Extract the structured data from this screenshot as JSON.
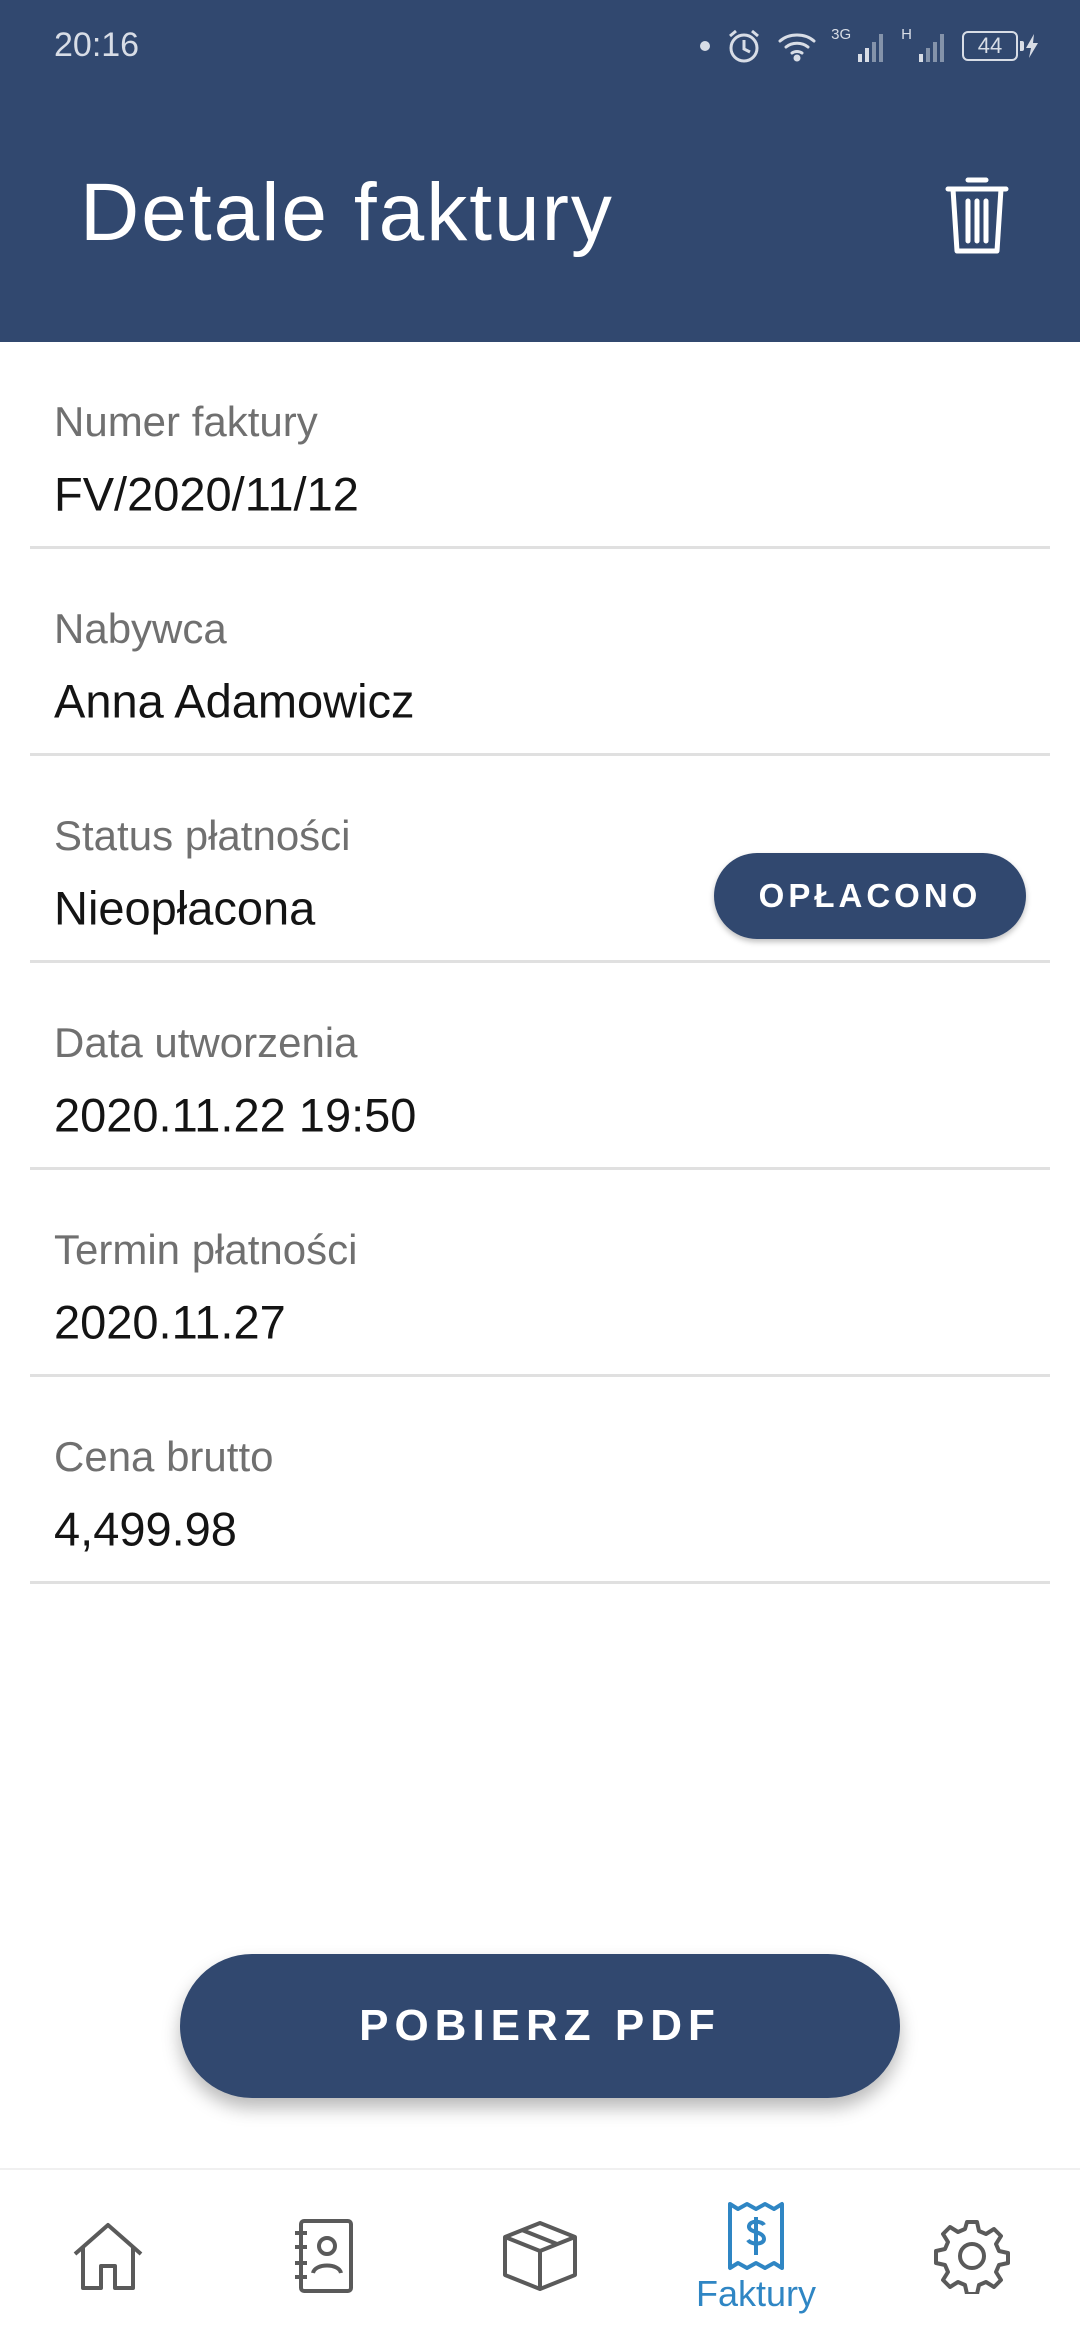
{
  "status_bar": {
    "time": "20:16",
    "network_3g": "3G",
    "network_h": "H",
    "battery": "44"
  },
  "header": {
    "title": "Detale faktury",
    "delete_icon": "trash-icon"
  },
  "details": [
    {
      "label": "Numer faktury",
      "value": "FV/2020/11/12"
    },
    {
      "label": "Nabywca",
      "value": "Anna Adamowicz"
    },
    {
      "label": "Status płatności",
      "value": "Nieopłacona",
      "action_label": "OPŁACONO"
    },
    {
      "label": "Data utworzenia",
      "value": "2020.11.22 19:50"
    },
    {
      "label": "Termin płatności",
      "value": "2020.11.27"
    },
    {
      "label": "Cena brutto",
      "value": "4,499.98"
    }
  ],
  "pdf_button": {
    "label": "POBIERZ PDF"
  },
  "bottom_nav": {
    "items": [
      {
        "icon": "home-icon",
        "label": ""
      },
      {
        "icon": "contacts-icon",
        "label": ""
      },
      {
        "icon": "box-icon",
        "label": ""
      },
      {
        "icon": "invoice-icon",
        "label": "Faktury",
        "active": true
      },
      {
        "icon": "gear-icon",
        "label": ""
      }
    ]
  },
  "colors": {
    "primary": "#31486f",
    "active_nav": "#2f86c4",
    "inactive_icon": "#5a5a5a"
  }
}
